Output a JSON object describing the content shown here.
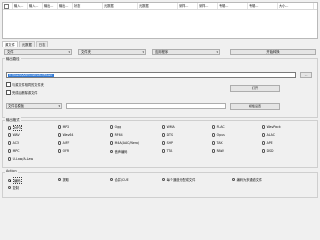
{
  "table": {
    "columns": [
      "",
      "输入...",
      "输入...",
      "输出...",
      "输出...",
      "状态",
      "元数据",
      "元数据",
      "采样...",
      "采样...",
      "专辑...",
      "专辑...",
      "大小..."
    ]
  },
  "tabs": [
    "源文件",
    "元数据",
    "日志"
  ],
  "toolbar": {
    "file_label": "文件",
    "action_label": "文件夹",
    "apply_label": "应用程序",
    "convert_label": "开始转换"
  },
  "output_path": {
    "legend": "输出路径",
    "value": "C:\\Users\\Administrator\\Music",
    "browse_label": "...",
    "same_folder_label": "与源文件相同的文件夹",
    "open_label": "打开",
    "delete_source_label": "完成后删除源文件",
    "naming_select": "文件名模板",
    "settings_label": "模板设置"
  },
  "output_format": {
    "legend": "输出格式",
    "options": [
      [
        "MP3",
        "MP2",
        "Ogg",
        "WMA",
        "FLAC",
        "WavPack"
      ],
      [
        "WAV",
        "Wav64",
        "RF64",
        "DTS",
        "Opus",
        "ALAC"
      ],
      [
        "AC3",
        "AIFF",
        "M4A(AAC/Nero)",
        "SHP",
        "TAK",
        "APE"
      ],
      [
        "MPC",
        "OFR",
        "音声编码",
        "TTA",
        "RAW",
        "DSD"
      ],
      [
        "U-Law/A-Law"
      ]
    ],
    "selected": "MP3"
  },
  "action": {
    "legend": "Action",
    "options": [
      [
        "编码",
        "提取",
        "合并/CUE",
        "每个通道分配成文件",
        "编码为多通道文件"
      ],
      [
        "复制"
      ]
    ],
    "selected": "编码"
  },
  "colors": {
    "accent": "#3079d6"
  }
}
